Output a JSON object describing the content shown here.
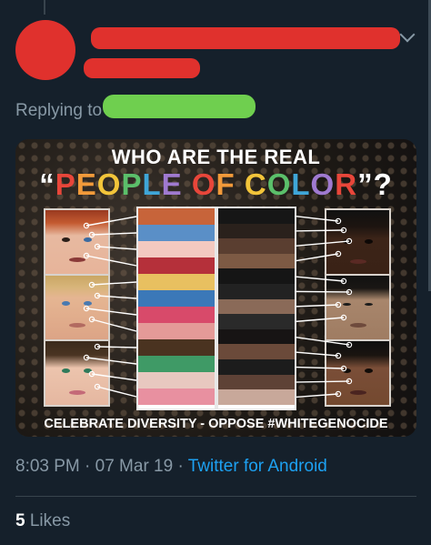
{
  "tweet": {
    "replying_to_label": "Replying to",
    "timestamp": "8:03 PM · 07 Mar 19 · ",
    "source": "Twitter for Android",
    "likes_count": "5",
    "likes_label": " Likes"
  },
  "image": {
    "title_line1": "WHO ARE THE REAL",
    "title_line2_parts": [
      {
        "text": "“",
        "color": "#ffffff"
      },
      {
        "text": "P",
        "color": "#e8463a"
      },
      {
        "text": "E",
        "color": "#f29a3a"
      },
      {
        "text": "O",
        "color": "#f2c43a"
      },
      {
        "text": "P",
        "color": "#5bbf6a"
      },
      {
        "text": "L",
        "color": "#3fa6d8"
      },
      {
        "text": "E",
        "color": "#a07ad0"
      },
      {
        "text": " ",
        "color": "#ffffff"
      },
      {
        "text": "O",
        "color": "#e8463a"
      },
      {
        "text": "F",
        "color": "#f29a3a"
      },
      {
        "text": " ",
        "color": "#ffffff"
      },
      {
        "text": "C",
        "color": "#f2c43a"
      },
      {
        "text": "O",
        "color": "#5bbf6a"
      },
      {
        "text": "L",
        "color": "#3fa6d8"
      },
      {
        "text": "O",
        "color": "#a07ad0"
      },
      {
        "text": "R",
        "color": "#e8463a"
      },
      {
        "text": "”?",
        "color": "#ffffff"
      }
    ],
    "bottom_caption": "CELEBRATE DIVERSITY - OPPOSE #WHITEGENOCIDE",
    "left_swatches": [
      "#c7643a",
      "#5a8fc7",
      "#f3c9c0",
      "#b5303a",
      "#e8c060",
      "#3b78b8",
      "#d84a6a",
      "#e49a98",
      "#4a3320",
      "#3f9a66",
      "#e8c8c0",
      "#e890a0"
    ],
    "right_swatches": [
      "#161616",
      "#2a211c",
      "#5a3e30",
      "#7d5a44",
      "#151515",
      "#222222",
      "#8a6a58",
      "#2a2a2a",
      "#171414",
      "#6b4a3a",
      "#1c1c1c",
      "#5e4236",
      "#c8a89a"
    ]
  }
}
